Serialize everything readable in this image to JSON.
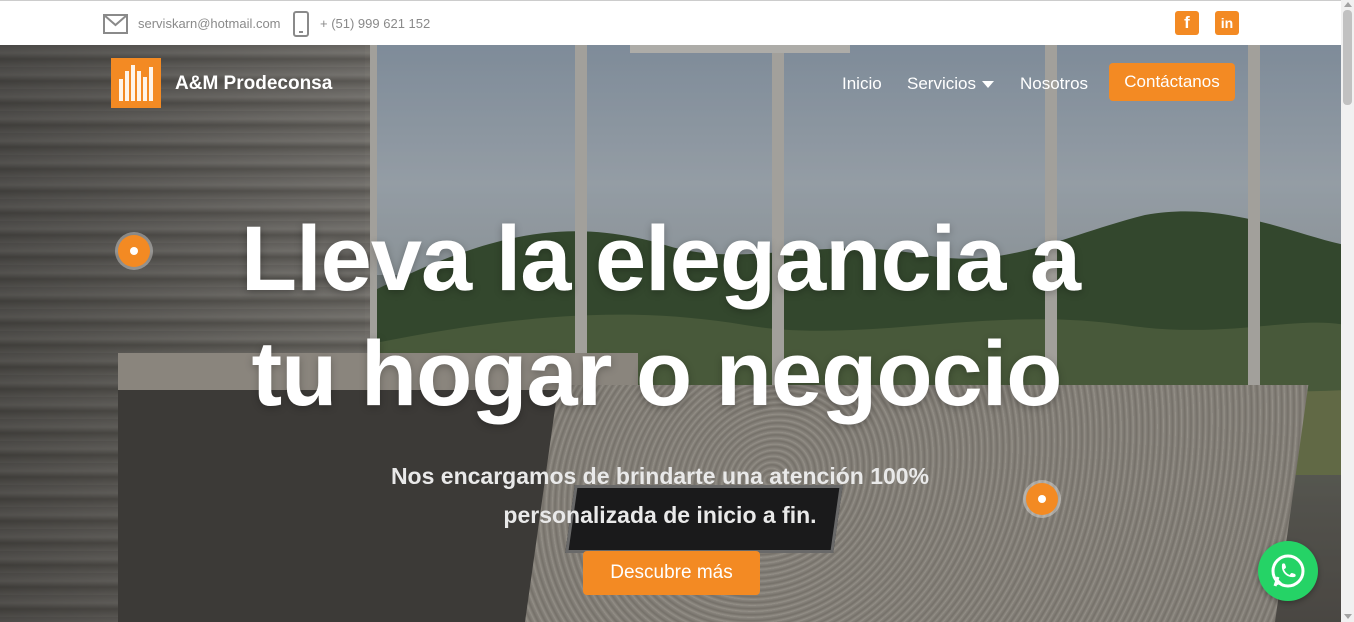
{
  "topbar": {
    "email": "serviskarn@hotmail.com",
    "phone": "+ (51) 999 621 152",
    "facebook_icon": "facebook-icon",
    "linkedin_icon": "linkedin-icon"
  },
  "nav": {
    "brand": "A&M Prodeconsa",
    "items": [
      {
        "label": "Inicio"
      },
      {
        "label": "Servicios"
      },
      {
        "label": "Nosotros"
      }
    ],
    "cta": "Contáctanos"
  },
  "hero": {
    "title_line1": "Lleva la elegancia a",
    "title_line2": "tu hogar o negocio",
    "subtitle": "Nos encargamos de brindarte una atención 100% personalizada de inicio a fin.",
    "button": "Descubre más"
  },
  "colors": {
    "accent": "#f38a23",
    "whatsapp": "#25d366"
  }
}
